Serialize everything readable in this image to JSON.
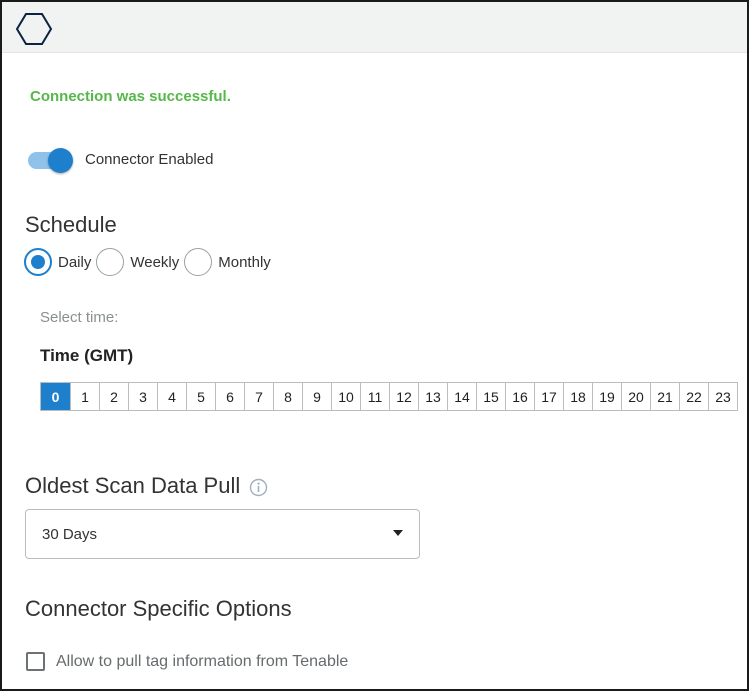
{
  "header": {
    "logo_icon": "hexagon-outline-icon"
  },
  "status": {
    "message": "Connection was successful.",
    "color": "#56b84a"
  },
  "connector": {
    "toggle_label": "Connector Enabled",
    "enabled": true,
    "accent": "#1e7fcd"
  },
  "schedule": {
    "title": "Schedule",
    "options": [
      {
        "label": "Daily",
        "checked": true
      },
      {
        "label": "Weekly",
        "checked": false
      },
      {
        "label": "Monthly",
        "checked": false
      }
    ],
    "select_time_label": "Select time:",
    "time_title": "Time (GMT)",
    "hours": [
      "0",
      "1",
      "2",
      "3",
      "4",
      "5",
      "6",
      "7",
      "8",
      "9",
      "10",
      "11",
      "12",
      "13",
      "14",
      "15",
      "16",
      "17",
      "18",
      "19",
      "20",
      "21",
      "22",
      "23"
    ],
    "selected_hour": "0"
  },
  "oldest_scan": {
    "title": "Oldest Scan Data Pull",
    "info_icon": "info-circle-icon",
    "value": "30 Days"
  },
  "options": {
    "title": "Connector Specific Options",
    "checkbox_label": "Allow to pull tag information from Tenable",
    "checked": false
  }
}
